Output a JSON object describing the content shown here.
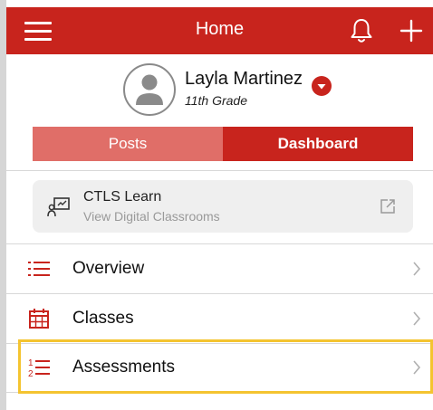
{
  "header": {
    "title": "Home",
    "menu_icon": "hamburger-menu-icon",
    "bell_icon": "bell-icon",
    "plus_icon": "plus-icon"
  },
  "profile": {
    "name": "Layla Martinez",
    "grade": "11th Grade",
    "dropdown_icon": "chevron-down-circle-icon"
  },
  "tabs": [
    {
      "label": "Posts",
      "selected": false
    },
    {
      "label": "Dashboard",
      "selected": true
    }
  ],
  "ctls_card": {
    "title": "CTLS Learn",
    "subtitle": "View Digital Classrooms",
    "icon": "presentation-icon",
    "action_icon": "external-link-icon"
  },
  "menu_items": [
    {
      "label": "Overview",
      "icon": "list-icon"
    },
    {
      "label": "Classes",
      "icon": "calendar-icon"
    },
    {
      "label": "Assessments",
      "icon": "numbered-list-icon",
      "highlighted": true
    }
  ],
  "colors": {
    "brand_red": "#c8241d",
    "light_red": "#e06e68",
    "highlight_yellow": "#f4c430",
    "card_bg": "#efefef"
  }
}
